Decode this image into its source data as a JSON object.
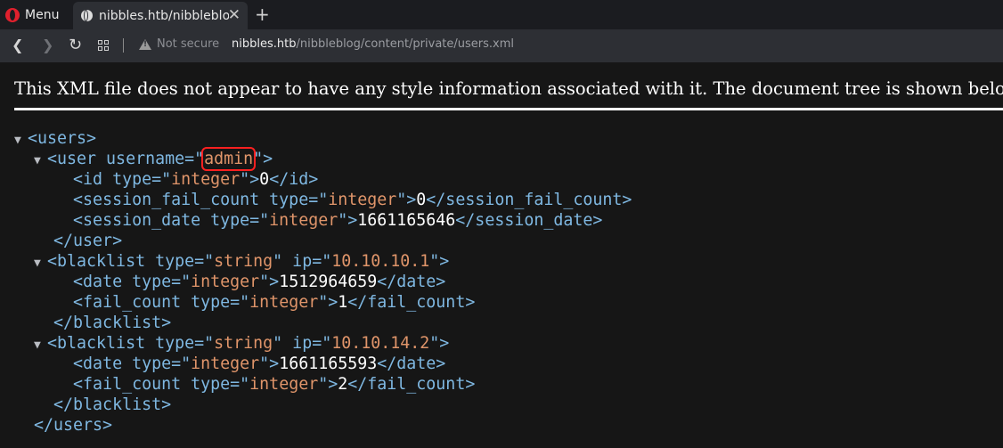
{
  "browser": {
    "menu_label": "Menu",
    "tab_title": "nibbles.htb/nibbleblog",
    "new_tab_glyph": "+",
    "close_glyph": "✕",
    "security_label": "Not secure",
    "url_host": "nibbles.htb",
    "url_path": "/nibbleblog/content/private/users.xml",
    "icons": [
      "opera-logo-icon",
      "globe-icon",
      "back-arrow-icon",
      "forward-arrow-icon",
      "reload-icon",
      "tabs-grid-icon",
      "warning-icon"
    ]
  },
  "page": {
    "info_message": "This XML file does not appear to have any style information associated with it. The document tree is shown below."
  },
  "xml": {
    "users_open": "<users>",
    "users_close": "</users>",
    "user": {
      "open_start": "<user username=\"",
      "username": "admin",
      "open_end": "\">",
      "close": "</user>",
      "id": {
        "open": "<id type=\"",
        "type": "integer",
        "mid": "\">",
        "value": "0",
        "close": "</id>"
      },
      "session_fail_count": {
        "open": "<session_fail_count type=\"",
        "type": "integer",
        "mid": "\">",
        "value": "0",
        "close": "</session_fail_count>"
      },
      "session_date": {
        "open": "<session_date type=\"",
        "type": "integer",
        "mid": "\">",
        "value": "1661165646",
        "close": "</session_date>"
      }
    },
    "blacklists": [
      {
        "open_start": "<blacklist type=\"",
        "type": "string",
        "ip_attr": "\" ip=\"",
        "ip": "10.10.10.1",
        "open_end": "\">",
        "close": "</blacklist>",
        "date": {
          "open": "<date type=\"",
          "type": "integer",
          "mid": "\">",
          "value": "1512964659",
          "close": "</date>"
        },
        "fail_count": {
          "open": "<fail_count type=\"",
          "type": "integer",
          "mid": "\">",
          "value": "1",
          "close": "</fail_count>"
        }
      },
      {
        "open_start": "<blacklist type=\"",
        "type": "string",
        "ip_attr": "\" ip=\"",
        "ip": "10.10.14.2",
        "open_end": "\">",
        "close": "</blacklist>",
        "date": {
          "open": "<date type=\"",
          "type": "integer",
          "mid": "\">",
          "value": "1661165593",
          "close": "</date>"
        },
        "fail_count": {
          "open": "<fail_count type=\"",
          "type": "integer",
          "mid": "\">",
          "value": "2",
          "close": "</fail_count>"
        }
      }
    ]
  },
  "colors": {
    "tag": "#7fb8e2",
    "attribute_value": "#e0956a",
    "highlight": "#ff2020"
  }
}
